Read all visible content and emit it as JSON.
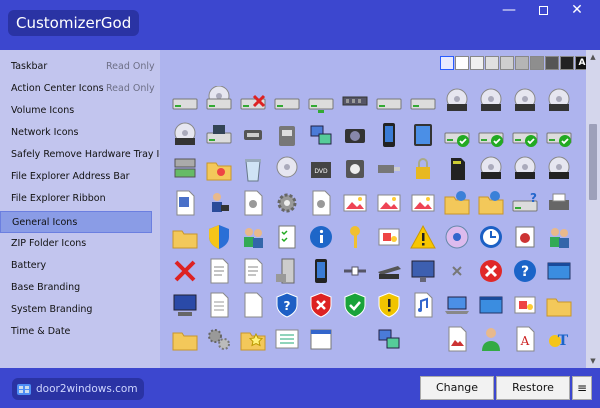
{
  "window": {
    "title": "CustomizerGod",
    "minimize_glyph": "—",
    "close_glyph": "✕"
  },
  "sidebar": {
    "items": [
      {
        "label": "Taskbar",
        "tag": "Read Only"
      },
      {
        "label": "Action Center Icons",
        "tag": "Read Only"
      },
      {
        "label": "Volume Icons",
        "tag": ""
      },
      {
        "label": "Network Icons",
        "tag": ""
      },
      {
        "label": "Safely Remove Hardware Tray Icon",
        "tag": ""
      },
      {
        "label": "File Explorer Address Bar",
        "tag": ""
      },
      {
        "label": "File Explorer Ribbon",
        "tag": ""
      },
      {
        "label": "General Icons",
        "tag": "",
        "selected": true
      },
      {
        "label": "ZIP Folder Icons",
        "tag": ""
      },
      {
        "label": "Battery",
        "tag": ""
      },
      {
        "label": "Base Branding",
        "tag": ""
      },
      {
        "label": "System Branding",
        "tag": ""
      },
      {
        "label": "Time & Date",
        "tag": ""
      }
    ]
  },
  "background_swatches": {
    "colors": [
      "#e8eaff",
      "#ffffff",
      "#f0f0f0",
      "#e0e0e0",
      "#cfcfcf",
      "#b5b5b5",
      "#8e8e8e",
      "#555555",
      "#222222"
    ],
    "text_swatch_label": "A",
    "selected_index": 0
  },
  "footer": {
    "brand": "door2windows.com",
    "change_label": "Change",
    "restore_label": "Restore",
    "menu_glyph": "≡"
  },
  "icons": {
    "rows": [
      [
        "drive-icon",
        "cd-drive-icon",
        "drive-error-icon",
        "drive-icon",
        "network-drive-icon",
        "memory-icon",
        "drive-icon",
        "drive-icon",
        "dvd-drive-icon",
        "dvd-r-drive-icon",
        "dvd-ram-drive-icon",
        "dvd-rom-drive-icon"
      ],
      [
        "dvd-rw-drive-icon",
        "floppy-drive-icon",
        "usb-drive-icon",
        "removable-drive-icon",
        "network-icon",
        "camera-icon",
        "phone-icon",
        "tablet-icon",
        "drive-ok-icon",
        "drive-ok-icon",
        "drive-ok-icon",
        "drive-ok-icon"
      ],
      [
        "server-drive-icon",
        "image-folder-icon",
        "recycle-bin-icon",
        "cd-icon",
        "dvd-icon",
        "media-player-icon",
        "usb-device-icon",
        "lock-icon",
        "sd-card-icon",
        "cd-r-icon",
        "cd-rom-icon",
        "cd-rw-icon"
      ],
      [
        "document-icon",
        "network-user-icon",
        "settings-doc-icon",
        "gear-icon",
        "settings-doc-icon",
        "picture-icon",
        "picture-icon",
        "picture-icon",
        "network-folder-icon",
        "network-folder-icon",
        "help-drive-icon",
        "printer-icon"
      ],
      [
        "folder-icon",
        "shield-icon",
        "users-icon",
        "task-icon",
        "info-icon",
        "key-icon",
        "puzzle-icon",
        "warning-icon",
        "disc-icon",
        "clock-icon",
        "certificate-icon",
        "users-icon"
      ],
      [
        "error-x-icon",
        "text-doc-icon",
        "text-doc-icon",
        "server-icon",
        "phone-icon",
        "cable-icon",
        "scanner-icon",
        "monitor-icon",
        "close-small-icon",
        "error-circle-icon",
        "help-circle-icon",
        "window-icon"
      ],
      [
        "computer-icon",
        "doc-icon",
        "blank-doc-icon",
        "help-shield-icon",
        "error-shield-icon",
        "ok-shield-icon",
        "warning-shield-icon",
        "music-icon",
        "laptop-icon",
        "window-icon",
        "puzzle-icon",
        "folder-icon"
      ],
      [
        "folder-icon",
        "gears-icon",
        "star-folder-icon",
        "list-icon",
        "calendar-icon",
        "",
        "network-icon",
        "",
        "picture-doc-icon",
        "user-icon",
        "font-icon",
        "font-doc-icon"
      ]
    ]
  }
}
